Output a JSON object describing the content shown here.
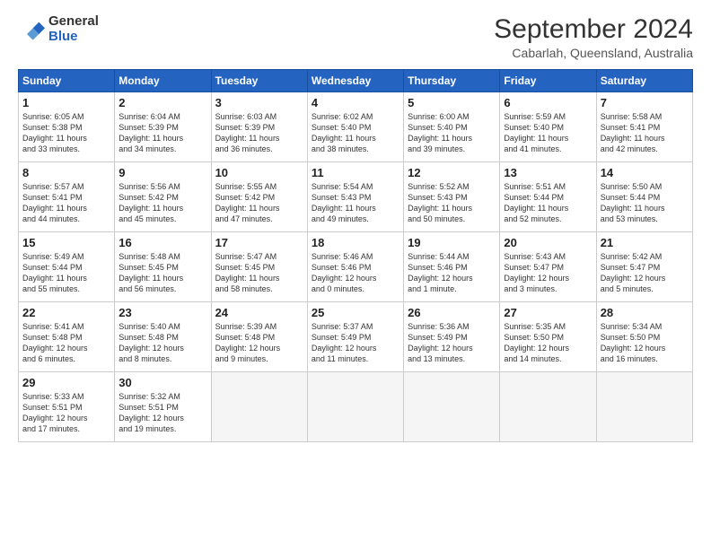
{
  "logo": {
    "general": "General",
    "blue": "Blue"
  },
  "title": "September 2024",
  "subtitle": "Cabarlah, Queensland, Australia",
  "weekdays": [
    "Sunday",
    "Monday",
    "Tuesday",
    "Wednesday",
    "Thursday",
    "Friday",
    "Saturday"
  ],
  "weeks": [
    [
      {
        "day": "1",
        "info": "Sunrise: 6:05 AM\nSunset: 5:38 PM\nDaylight: 11 hours\nand 33 minutes."
      },
      {
        "day": "2",
        "info": "Sunrise: 6:04 AM\nSunset: 5:39 PM\nDaylight: 11 hours\nand 34 minutes."
      },
      {
        "day": "3",
        "info": "Sunrise: 6:03 AM\nSunset: 5:39 PM\nDaylight: 11 hours\nand 36 minutes."
      },
      {
        "day": "4",
        "info": "Sunrise: 6:02 AM\nSunset: 5:40 PM\nDaylight: 11 hours\nand 38 minutes."
      },
      {
        "day": "5",
        "info": "Sunrise: 6:00 AM\nSunset: 5:40 PM\nDaylight: 11 hours\nand 39 minutes."
      },
      {
        "day": "6",
        "info": "Sunrise: 5:59 AM\nSunset: 5:40 PM\nDaylight: 11 hours\nand 41 minutes."
      },
      {
        "day": "7",
        "info": "Sunrise: 5:58 AM\nSunset: 5:41 PM\nDaylight: 11 hours\nand 42 minutes."
      }
    ],
    [
      {
        "day": "8",
        "info": "Sunrise: 5:57 AM\nSunset: 5:41 PM\nDaylight: 11 hours\nand 44 minutes."
      },
      {
        "day": "9",
        "info": "Sunrise: 5:56 AM\nSunset: 5:42 PM\nDaylight: 11 hours\nand 45 minutes."
      },
      {
        "day": "10",
        "info": "Sunrise: 5:55 AM\nSunset: 5:42 PM\nDaylight: 11 hours\nand 47 minutes."
      },
      {
        "day": "11",
        "info": "Sunrise: 5:54 AM\nSunset: 5:43 PM\nDaylight: 11 hours\nand 49 minutes."
      },
      {
        "day": "12",
        "info": "Sunrise: 5:52 AM\nSunset: 5:43 PM\nDaylight: 11 hours\nand 50 minutes."
      },
      {
        "day": "13",
        "info": "Sunrise: 5:51 AM\nSunset: 5:44 PM\nDaylight: 11 hours\nand 52 minutes."
      },
      {
        "day": "14",
        "info": "Sunrise: 5:50 AM\nSunset: 5:44 PM\nDaylight: 11 hours\nand 53 minutes."
      }
    ],
    [
      {
        "day": "15",
        "info": "Sunrise: 5:49 AM\nSunset: 5:44 PM\nDaylight: 11 hours\nand 55 minutes."
      },
      {
        "day": "16",
        "info": "Sunrise: 5:48 AM\nSunset: 5:45 PM\nDaylight: 11 hours\nand 56 minutes."
      },
      {
        "day": "17",
        "info": "Sunrise: 5:47 AM\nSunset: 5:45 PM\nDaylight: 11 hours\nand 58 minutes."
      },
      {
        "day": "18",
        "info": "Sunrise: 5:46 AM\nSunset: 5:46 PM\nDaylight: 12 hours\nand 0 minutes."
      },
      {
        "day": "19",
        "info": "Sunrise: 5:44 AM\nSunset: 5:46 PM\nDaylight: 12 hours\nand 1 minute."
      },
      {
        "day": "20",
        "info": "Sunrise: 5:43 AM\nSunset: 5:47 PM\nDaylight: 12 hours\nand 3 minutes."
      },
      {
        "day": "21",
        "info": "Sunrise: 5:42 AM\nSunset: 5:47 PM\nDaylight: 12 hours\nand 5 minutes."
      }
    ],
    [
      {
        "day": "22",
        "info": "Sunrise: 5:41 AM\nSunset: 5:48 PM\nDaylight: 12 hours\nand 6 minutes."
      },
      {
        "day": "23",
        "info": "Sunrise: 5:40 AM\nSunset: 5:48 PM\nDaylight: 12 hours\nand 8 minutes."
      },
      {
        "day": "24",
        "info": "Sunrise: 5:39 AM\nSunset: 5:48 PM\nDaylight: 12 hours\nand 9 minutes."
      },
      {
        "day": "25",
        "info": "Sunrise: 5:37 AM\nSunset: 5:49 PM\nDaylight: 12 hours\nand 11 minutes."
      },
      {
        "day": "26",
        "info": "Sunrise: 5:36 AM\nSunset: 5:49 PM\nDaylight: 12 hours\nand 13 minutes."
      },
      {
        "day": "27",
        "info": "Sunrise: 5:35 AM\nSunset: 5:50 PM\nDaylight: 12 hours\nand 14 minutes."
      },
      {
        "day": "28",
        "info": "Sunrise: 5:34 AM\nSunset: 5:50 PM\nDaylight: 12 hours\nand 16 minutes."
      }
    ],
    [
      {
        "day": "29",
        "info": "Sunrise: 5:33 AM\nSunset: 5:51 PM\nDaylight: 12 hours\nand 17 minutes."
      },
      {
        "day": "30",
        "info": "Sunrise: 5:32 AM\nSunset: 5:51 PM\nDaylight: 12 hours\nand 19 minutes."
      },
      {
        "day": "",
        "info": ""
      },
      {
        "day": "",
        "info": ""
      },
      {
        "day": "",
        "info": ""
      },
      {
        "day": "",
        "info": ""
      },
      {
        "day": "",
        "info": ""
      }
    ]
  ]
}
